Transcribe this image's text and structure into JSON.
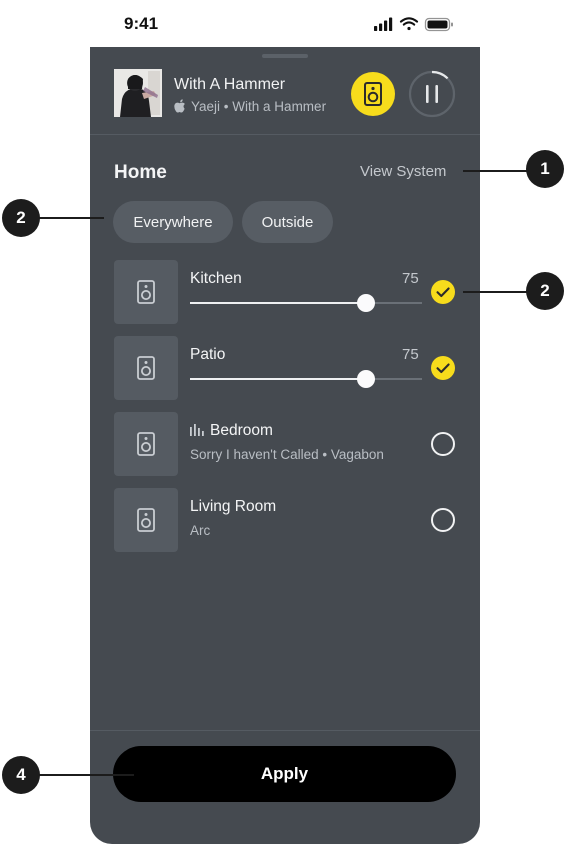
{
  "status_bar": {
    "time": "9:41"
  },
  "now_playing": {
    "title": "With A Hammer",
    "artist": "Yaeji",
    "album": "With a Hammer",
    "separator": "•"
  },
  "system": {
    "title": "Home",
    "view_system_label": "View System"
  },
  "groups": [
    {
      "label": "Everywhere"
    },
    {
      "label": "Outside"
    }
  ],
  "rooms": [
    {
      "name": "Kitchen",
      "volume": "75",
      "volume_level": 0.76,
      "selected": true
    },
    {
      "name": "Patio",
      "volume": "75",
      "volume_level": 0.76,
      "selected": true
    },
    {
      "name": "Bedroom",
      "subtitle": "Sorry I haven't Called • Vagabon",
      "playing": true,
      "selected": false
    },
    {
      "name": "Living Room",
      "subtitle": "Arc",
      "selected": false
    }
  ],
  "apply_label": "Apply",
  "callouts": [
    "1",
    "2",
    "2",
    "4"
  ],
  "colors": {
    "accent": "#f7dc1c",
    "sheet_background": "#454a50",
    "tile_background": "#555b62",
    "button_background": "#000000"
  }
}
